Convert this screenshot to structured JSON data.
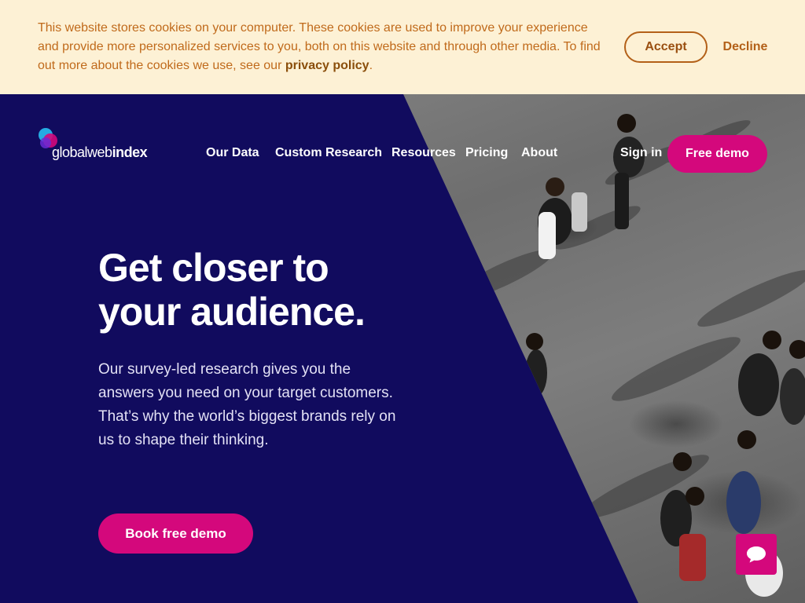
{
  "cookie_banner": {
    "text": "This website stores cookies on your computer. These cookies are used to improve your experience and provide more personalized services to you, both on this website and through other media. To find out more about the cookies we use, see our ",
    "link_label": "privacy policy",
    "trailing": ".",
    "accept_label": "Accept",
    "decline_label": "Decline"
  },
  "header": {
    "logo": {
      "part1": "global",
      "part2": "web",
      "part3": "index"
    },
    "nav": [
      "Our Data",
      "Custom Research",
      "Resources",
      "Pricing",
      "About"
    ],
    "sign_in_label": "Sign in",
    "free_demo_label": "Free demo"
  },
  "hero": {
    "headline_line1": "Get closer to",
    "headline_line2": "your audience.",
    "subtext": "Our survey-led research gives you the answers you need on your target customers. That’s why the world’s biggest brands rely on us to shape their thinking.",
    "cta_label": "Book free demo"
  },
  "icons": {
    "logo": "overlapping-circles-logo",
    "chat": "chat-bubble-icon"
  },
  "colors": {
    "navy": "#110b5e",
    "magenta": "#d4087c",
    "cookie_bg": "#fdf1d5",
    "cookie_text": "#c06a1b"
  }
}
